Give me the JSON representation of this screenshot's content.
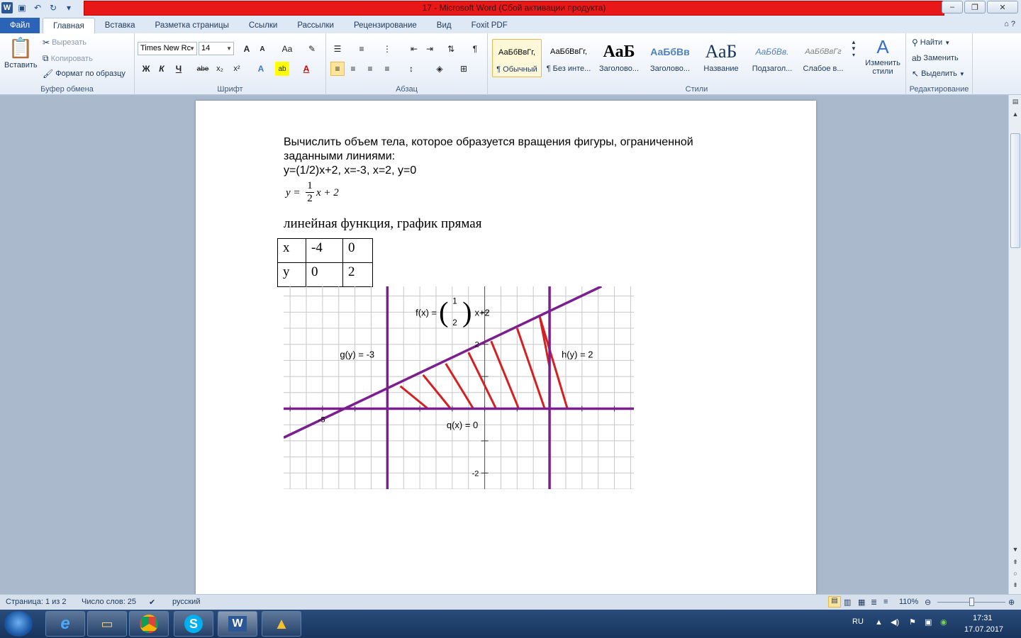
{
  "window": {
    "title": "17  -  Microsoft Word (Сбой активации продукта)",
    "app_letter": "W"
  },
  "tabs": [
    "Файл",
    "Главная",
    "Вставка",
    "Разметка страницы",
    "Ссылки",
    "Рассылки",
    "Рецензирование",
    "Вид",
    "Foxit PDF"
  ],
  "ribbon": {
    "clipboard": {
      "paste": "Вставить",
      "cut": "Вырезать",
      "copy": "Копировать",
      "format_painter": "Формат по образцу",
      "label": "Буфер обмена"
    },
    "font": {
      "font_name": "Times New Rc",
      "font_size": "14",
      "grow": "A",
      "shrink": "A",
      "case": "Aa",
      "bold": "Ж",
      "italic": "К",
      "underline": "Ч",
      "strike": "abe",
      "subscript": "x₂",
      "superscript": "x²",
      "label": "Шрифт"
    },
    "paragraph": {
      "label": "Абзац",
      "pilcrow": "¶"
    },
    "styles": {
      "items": [
        {
          "preview": "АаБбВвГг,",
          "name": "¶ Обычный"
        },
        {
          "preview": "АаБбВвГг,",
          "name": "¶ Без инте..."
        },
        {
          "preview": "АаБ",
          "name": "Заголово..."
        },
        {
          "preview": "АаБбВв",
          "name": "Заголово..."
        },
        {
          "preview": "АаБ",
          "name": "Название"
        },
        {
          "preview": "АаБбВв.",
          "name": "Подзагол..."
        },
        {
          "preview": "АаБбВвГг",
          "name": "Слабое в..."
        }
      ],
      "change": "Изменить стили",
      "label": "Стили"
    },
    "editing": {
      "find": "Найти",
      "replace": "Заменить",
      "select": "Выделить",
      "label": "Редактирование"
    }
  },
  "document": {
    "task_line1": "Вычислить объем тела, которое образуется вращения фигуры, ограниченной",
    "task_line2": "заданными линиями:",
    "task_line3": "y=(1/2)x+2, x=-3, x=2, y=0",
    "formula_y": "y =",
    "formula_num": "1",
    "formula_den": "2",
    "formula_rest": "x + 2",
    "description": "линейная функция, график прямая",
    "table": [
      [
        "x",
        "-4",
        "0"
      ],
      [
        "y",
        "0",
        "2"
      ]
    ]
  },
  "chart_data": {
    "type": "line",
    "xlim": [
      -6.2,
      4.6
    ],
    "ylim": [
      -2.5,
      3.8
    ],
    "series": [
      {
        "label": "f(x) = (1/2)x+2",
        "x": [
          -6.2,
          3.6
        ],
        "y": [
          -0.9,
          3.8
        ]
      },
      {
        "label": "g(y) = -3",
        "x": [
          -3,
          -3
        ],
        "y": [
          -2.5,
          3.8
        ]
      },
      {
        "label": "h(y) = 2",
        "x": [
          2,
          2
        ],
        "y": [
          -2.5,
          3.8
        ]
      },
      {
        "label": "q(x) = 0",
        "x": [
          -6.2,
          4.6
        ],
        "y": [
          0,
          0
        ]
      }
    ],
    "hatch_x": [
      -2.6,
      -1.9,
      -1.2,
      -0.5,
      0.2,
      1.0,
      1.7
    ],
    "labels": {
      "f_prefix": "f(x) =",
      "f_num": "1",
      "f_den": "2",
      "f_suffix": "x+2",
      "g": "g(y) = -3",
      "h": "h(y) = 2",
      "q": "q(x) = 0"
    },
    "tick_labels": {
      "x_minus5": "-5",
      "y_2": "2",
      "y_minus2": "-2"
    },
    "colors": {
      "line": "#7b1f8e",
      "hatch": "#d42020",
      "grid": "#c8c8c8"
    }
  },
  "statusbar": {
    "page": "Страница: 1 из 2",
    "words": "Число слов: 25",
    "language": "русский",
    "zoom": "110%"
  },
  "taskbar": {
    "lang": "RU",
    "time": "17:31",
    "date": "17.07.2017"
  }
}
